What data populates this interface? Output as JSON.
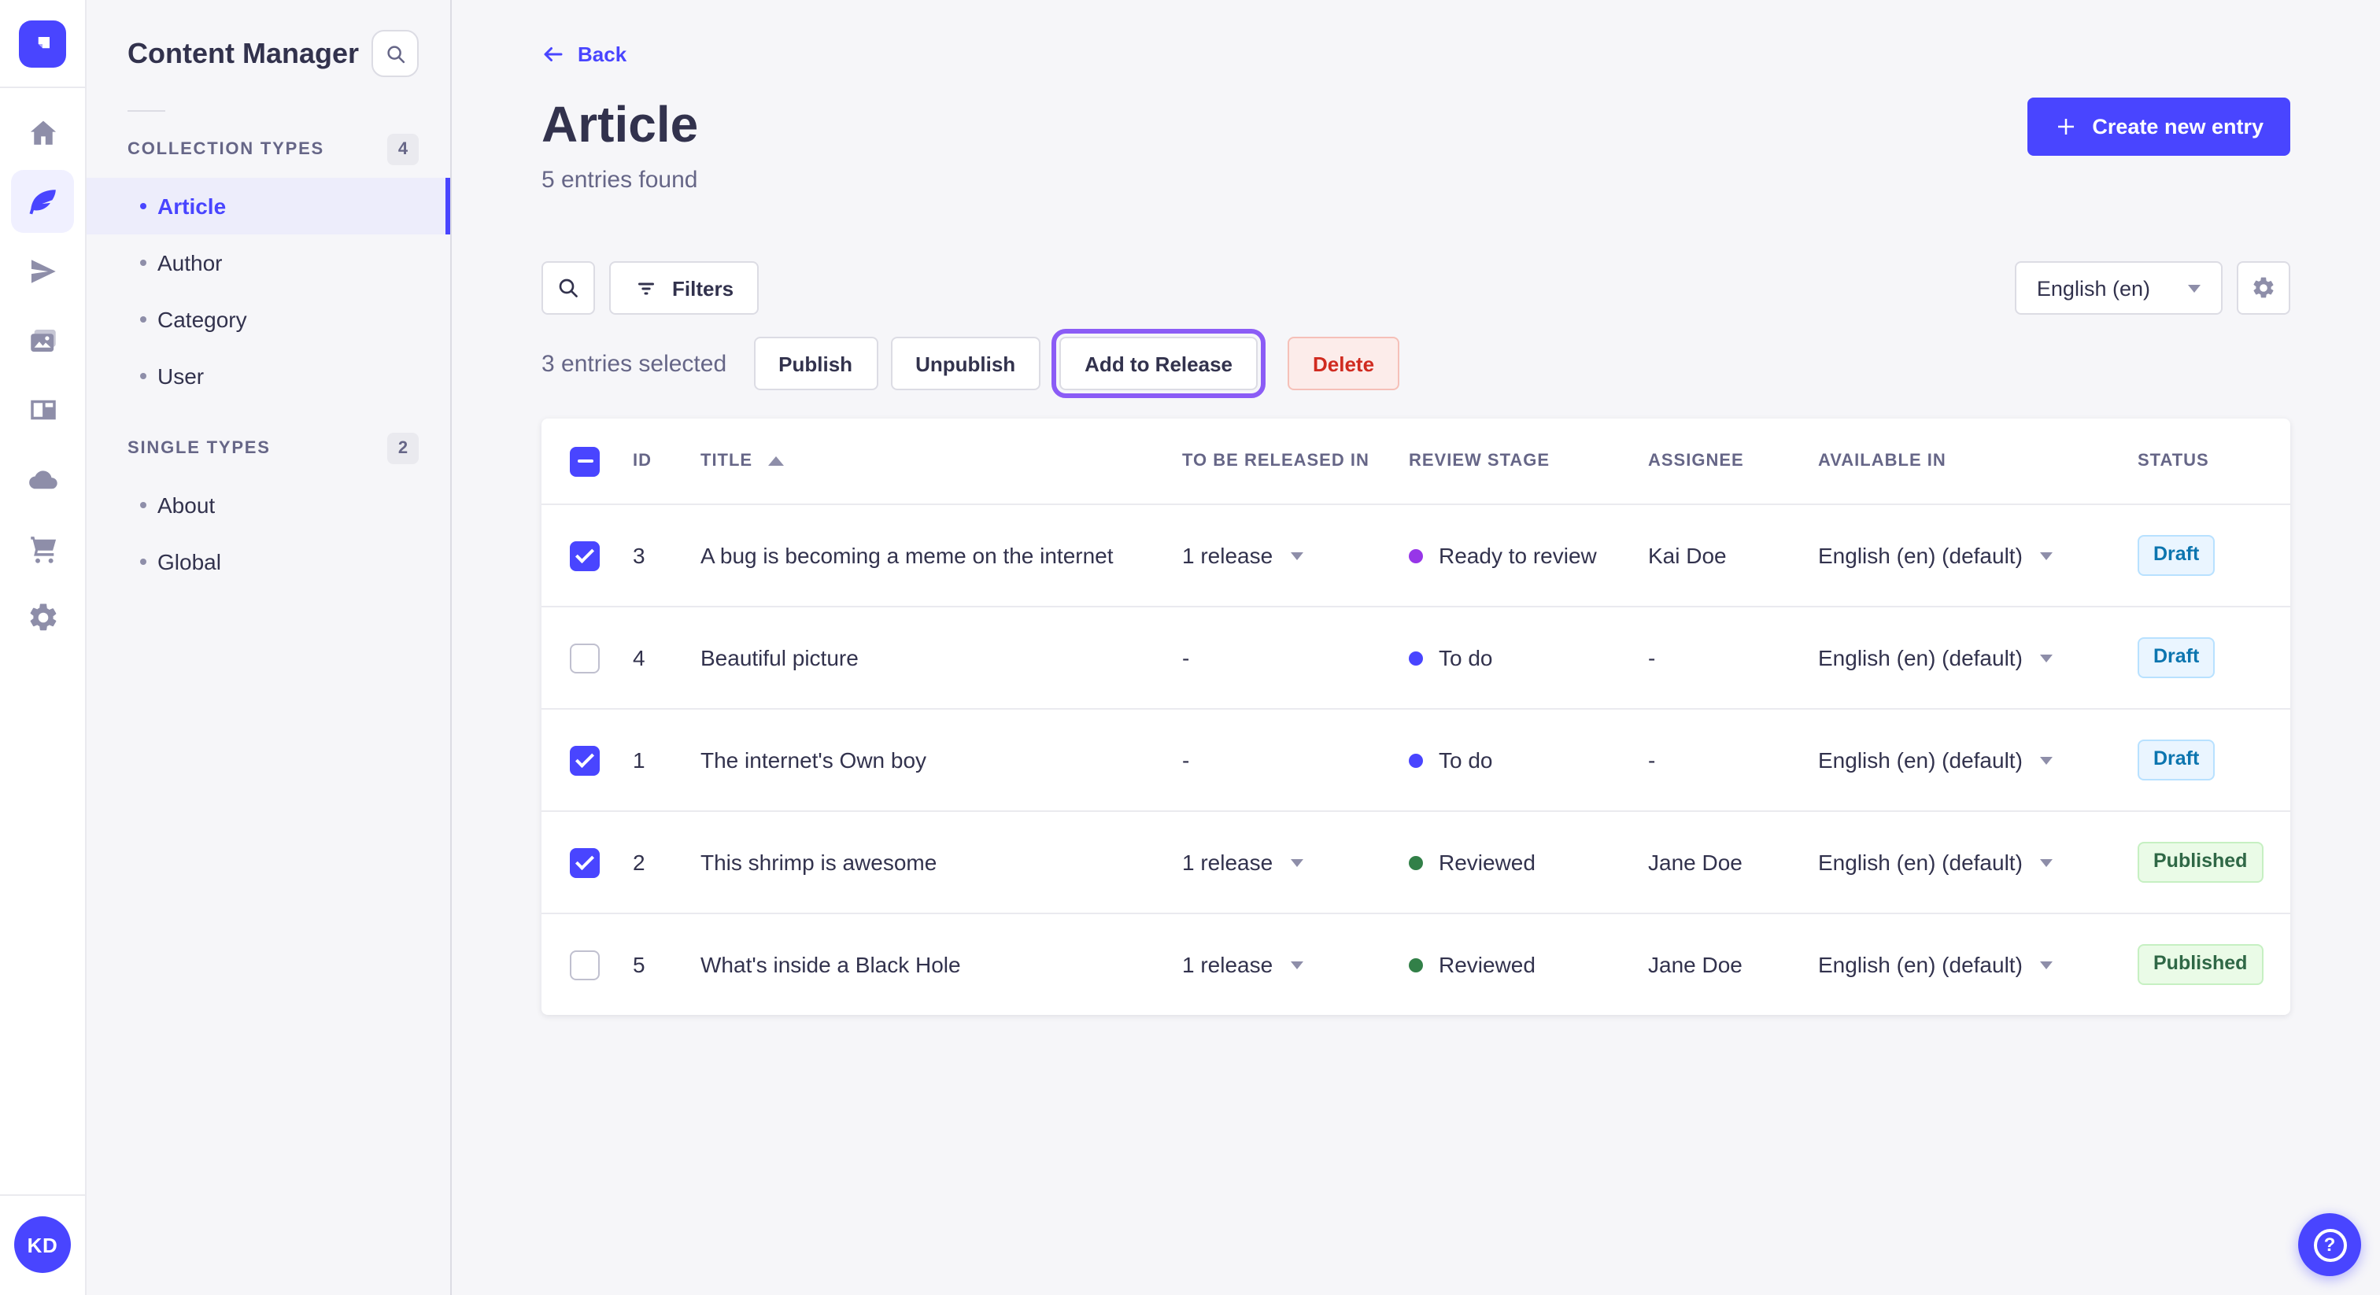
{
  "nav_rail": {
    "icons": [
      "strapi-logo",
      "home",
      "content-manager",
      "releases",
      "media-library",
      "content-type-builder",
      "cloud",
      "marketplace",
      "settings"
    ],
    "active_icon": "content-manager",
    "avatar_initials": "KD"
  },
  "sidebar": {
    "title": "Content Manager",
    "sections": [
      {
        "label": "COLLECTION TYPES",
        "badge": "4",
        "items": [
          {
            "label": "Article",
            "active": true
          },
          {
            "label": "Author",
            "active": false
          },
          {
            "label": "Category",
            "active": false
          },
          {
            "label": "User",
            "active": false
          }
        ]
      },
      {
        "label": "SINGLE TYPES",
        "badge": "2",
        "items": [
          {
            "label": "About",
            "active": false
          },
          {
            "label": "Global",
            "active": false
          }
        ]
      }
    ]
  },
  "header": {
    "back_label": "Back",
    "title": "Article",
    "subtitle": "5 entries found",
    "create_button_label": "Create new entry"
  },
  "toolbar": {
    "filters_label": "Filters",
    "locale_value": "English (en)"
  },
  "selection_bar": {
    "count_label": "3 entries selected",
    "publish_label": "Publish",
    "unpublish_label": "Unpublish",
    "add_to_release_label": "Add to Release",
    "delete_label": "Delete"
  },
  "table": {
    "select_all_state": "indeterminate",
    "headers": {
      "id": "ID",
      "title": "TITLE",
      "release": "TO BE RELEASED IN",
      "stage": "REVIEW STAGE",
      "assignee": "ASSIGNEE",
      "available": "AVAILABLE IN",
      "status": "STATUS"
    },
    "rows": [
      {
        "checked": true,
        "id": "3",
        "title": "A bug is becoming a meme on the internet",
        "release": "1 release",
        "stage": "Ready to review",
        "stage_color": "#9736E8",
        "assignee": "Kai Doe",
        "available": "English (en) (default)",
        "status": "Draft"
      },
      {
        "checked": false,
        "id": "4",
        "title": "Beautiful picture",
        "release": "-",
        "stage": "To do",
        "stage_color": "#4945FF",
        "assignee": "-",
        "available": "English (en) (default)",
        "status": "Draft"
      },
      {
        "checked": true,
        "id": "1",
        "title": "The internet's Own boy",
        "release": "-",
        "stage": "To do",
        "stage_color": "#4945FF",
        "assignee": "-",
        "available": "English (en) (default)",
        "status": "Draft"
      },
      {
        "checked": true,
        "id": "2",
        "title": "This shrimp is awesome",
        "release": "1 release",
        "stage": "Reviewed",
        "stage_color": "#328048",
        "assignee": "Jane Doe",
        "available": "English (en) (default)",
        "status": "Published"
      },
      {
        "checked": false,
        "id": "5",
        "title": "What's inside a Black Hole",
        "release": "1 release",
        "stage": "Reviewed",
        "stage_color": "#328048",
        "assignee": "Jane Doe",
        "available": "English (en) (default)",
        "status": "Published"
      }
    ]
  },
  "fab": {
    "help_icon": "?"
  },
  "colors": {
    "primary": "#4945FF",
    "page_background": "#F6F6F9",
    "highlight_outline": "#8B5CF6",
    "danger_text": "#D02B20",
    "draft_badge_text": "#0C75AF",
    "published_badge_text": "#2F6846",
    "stage_ready_to_review": "#9736E8",
    "stage_to_do": "#4945FF",
    "stage_reviewed": "#328048"
  }
}
